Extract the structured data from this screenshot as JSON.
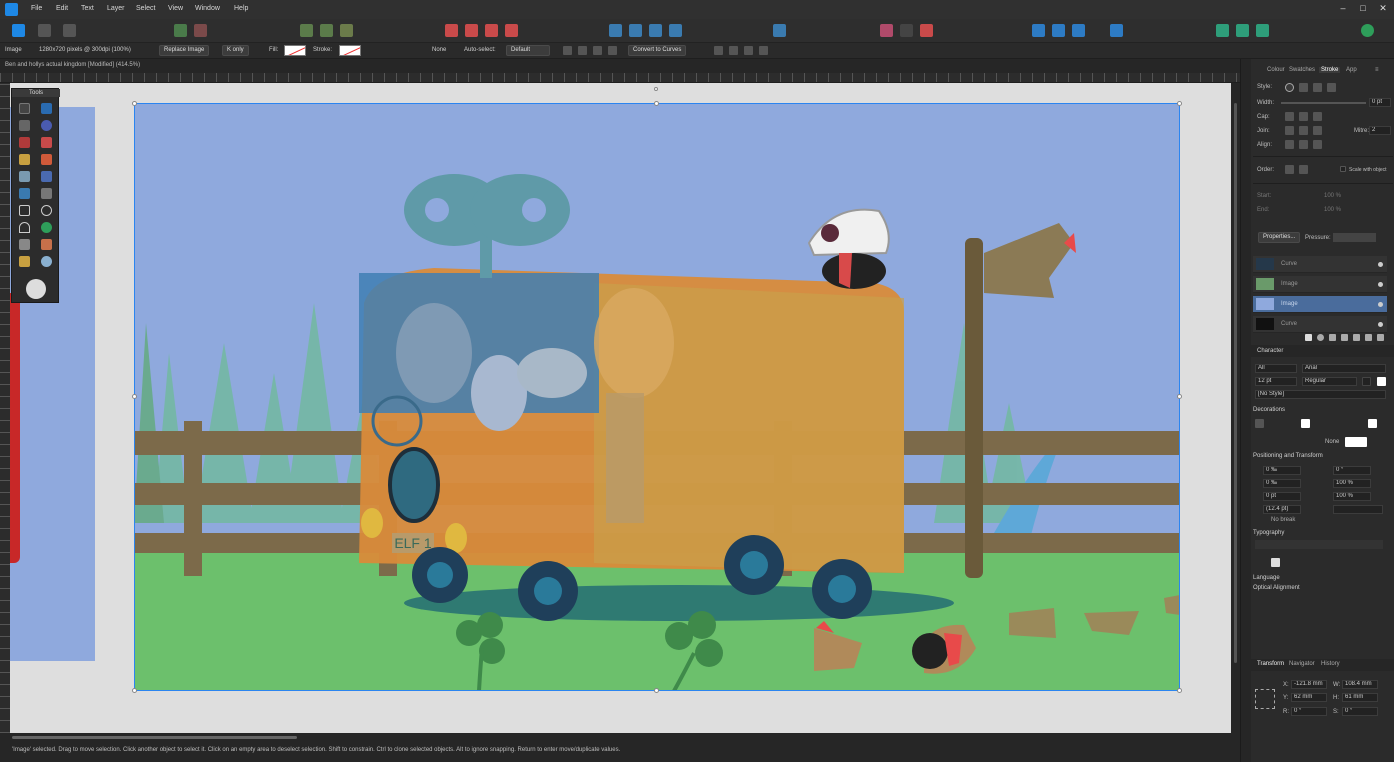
{
  "menubar": {
    "items": [
      "File",
      "Edit",
      "Text",
      "Layer",
      "Select",
      "View",
      "Window",
      "Help"
    ]
  },
  "context_toolbar": {
    "layer_type": "Image",
    "image_info": "1280x720 pixels @ 300dpi (100%)",
    "replace_image": "Replace Image",
    "k_only": "K only",
    "fill_label": "Fill:",
    "stroke_label": "Stroke:",
    "stroke_value": "None",
    "auto_select_label": "Auto-select:",
    "auto_select_value": "Default",
    "convert_to_curves": "Convert to Curves"
  },
  "document": {
    "title": "Ben and hollys actual kingdom [Modified] (414.5%)"
  },
  "tools_panel": {
    "title": "Tools"
  },
  "status_bar": {
    "text": "'Image' selected. Drag to move selection. Click another object to select it. Click on an empty area to deselect selection. Shift to constrain. Ctrl to clone selected objects. Alt to ignore snapping. Return to enter move/duplicate values."
  },
  "right_panel": {
    "tabs": [
      "Colour",
      "Swatches",
      "Stroke",
      "App"
    ],
    "active_tab": "Stroke",
    "stroke": {
      "style_label": "Style:",
      "width_label": "Width:",
      "width_value": "0 pt",
      "cap_label": "Cap:",
      "join_label": "Join:",
      "mitre_label": "Mitre:",
      "mitre_value": "2",
      "align_label": "Align:",
      "order_label": "Order:",
      "scale_with_object": "Scale with object",
      "start_label": "Start:",
      "end_label": "End:",
      "start_pct": "100 %",
      "end_pct": "100 %",
      "properties_button": "Properties...",
      "pressure_label": "Pressure:"
    },
    "layers": [
      {
        "name": "Curve"
      },
      {
        "name": "Image"
      },
      {
        "name": "Image"
      },
      {
        "name": "Curve"
      }
    ],
    "character": {
      "title": "Character",
      "font_collection": "All",
      "font_family": "Arial",
      "font_size": "12 pt",
      "font_weight": "Regular",
      "style": "[No Style]",
      "decorations_title": "Decorations",
      "decorations_value": "None",
      "positioning_title": "Positioning and Transform",
      "tracking": "0 ‰",
      "kerning": "0 ‰",
      "baseline": "0 pt",
      "leading": "(12.4 pt)",
      "rotation": "0 °",
      "scale_h": "100 %",
      "scale_v": "100 %",
      "no_break": "No break",
      "typography_title": "Typography",
      "language_title": "Language",
      "optical_title": "Optical Alignment"
    },
    "transform_tabs": [
      "Transform",
      "Navigator",
      "History"
    ],
    "transform": {
      "x": "-121.8 mm",
      "y": "62 mm",
      "w": "108.4 mm",
      "h": "61 mm",
      "r": "0 °",
      "s": "0 °",
      "x_label": "X:",
      "y_label": "Y:",
      "w_label": "W:",
      "h_label": "H:",
      "r_label": "R:",
      "s_label": "S:"
    }
  },
  "artwork": {
    "plate_text": "ELF 1"
  },
  "colors": {
    "accent": "#1e88e5",
    "sky": "#8fa9dd",
    "grass": "#6cc06c",
    "van": "#d98b3a",
    "canvas_bg": "#dedede"
  }
}
